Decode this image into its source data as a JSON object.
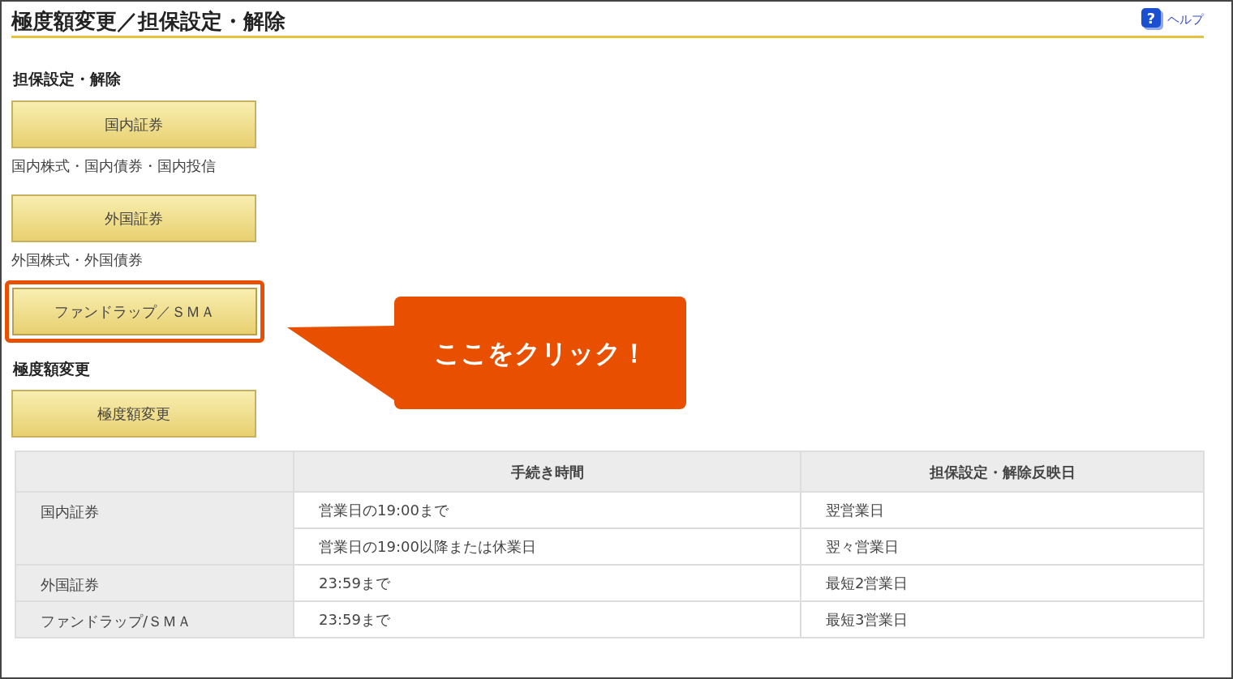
{
  "page": {
    "title": "極度額変更／担保設定・解除",
    "help": "ヘルプ",
    "help_icon": "?"
  },
  "sections": [
    {
      "heading": "担保設定・解除",
      "buttons": [
        {
          "label": "国内証券",
          "note": "国内株式・国内債券・国内投信",
          "highlighted": false
        },
        {
          "label": "外国証券",
          "note": "外国株式・外国債券",
          "highlighted": false
        },
        {
          "label": "ファンドラップ／ＳＭＡ",
          "highlighted": true
        }
      ]
    },
    {
      "heading": "極度額変更",
      "buttons": [
        {
          "label": "極度額変更",
          "highlighted": false
        }
      ]
    }
  ],
  "callout": {
    "text": "ここをクリック！"
  },
  "table": {
    "columns": [
      "手続き時間",
      "担保設定・解除反映日"
    ],
    "rows": [
      {
        "category": "国内証券",
        "entries": [
          {
            "time": "営業日の19:00まで",
            "date": "翌営業日"
          },
          {
            "time": "営業日の19:00以降または休業日",
            "date": "翌々営業日"
          }
        ]
      },
      {
        "category": "外国証券",
        "entries": [
          {
            "time": "23:59まで",
            "date": "最短2営業日"
          }
        ]
      },
      {
        "category": "ファンドラップ/ＳＭＡ",
        "entries": [
          {
            "time": "23:59まで",
            "date": "最短3営業日"
          }
        ]
      }
    ]
  }
}
